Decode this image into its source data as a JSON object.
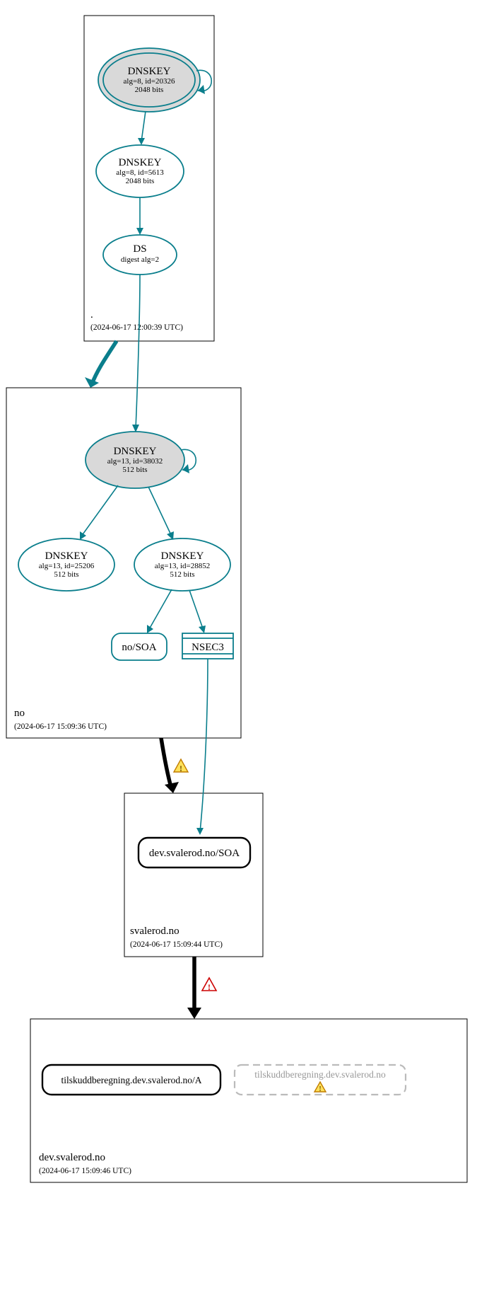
{
  "zones": {
    "root": {
      "label": ".",
      "timestamp": "(2024-06-17 12:00:39 UTC)"
    },
    "no": {
      "label": "no",
      "timestamp": "(2024-06-17 15:09:36 UTC)"
    },
    "svalerod": {
      "label": "svalerod.no",
      "timestamp": "(2024-06-17 15:09:44 UTC)"
    },
    "dev_svalerod": {
      "label": "dev.svalerod.no",
      "timestamp": "(2024-06-17 15:09:46 UTC)"
    }
  },
  "nodes": {
    "root_ksk": {
      "title": "DNSKEY",
      "alg": "alg=8, id=20326",
      "bits": "2048 bits"
    },
    "root_zsk": {
      "title": "DNSKEY",
      "alg": "alg=8, id=5613",
      "bits": "2048 bits"
    },
    "root_ds": {
      "title": "DS",
      "digest": "digest alg=2"
    },
    "no_ksk": {
      "title": "DNSKEY",
      "alg": "alg=13, id=38032",
      "bits": "512 bits"
    },
    "no_zsk1": {
      "title": "DNSKEY",
      "alg": "alg=13, id=25206",
      "bits": "512 bits"
    },
    "no_zsk2": {
      "title": "DNSKEY",
      "alg": "alg=13, id=28852",
      "bits": "512 bits"
    },
    "no_soa": {
      "label": "no/SOA"
    },
    "no_nsec3": {
      "label": "NSEC3"
    },
    "svalerod_soa": {
      "label": "dev.svalerod.no/SOA"
    },
    "dev_a": {
      "label": "tilskuddberegning.dev.svalerod.no/A"
    },
    "dev_extra": {
      "label": "tilskuddberegning.dev.svalerod.no"
    }
  }
}
